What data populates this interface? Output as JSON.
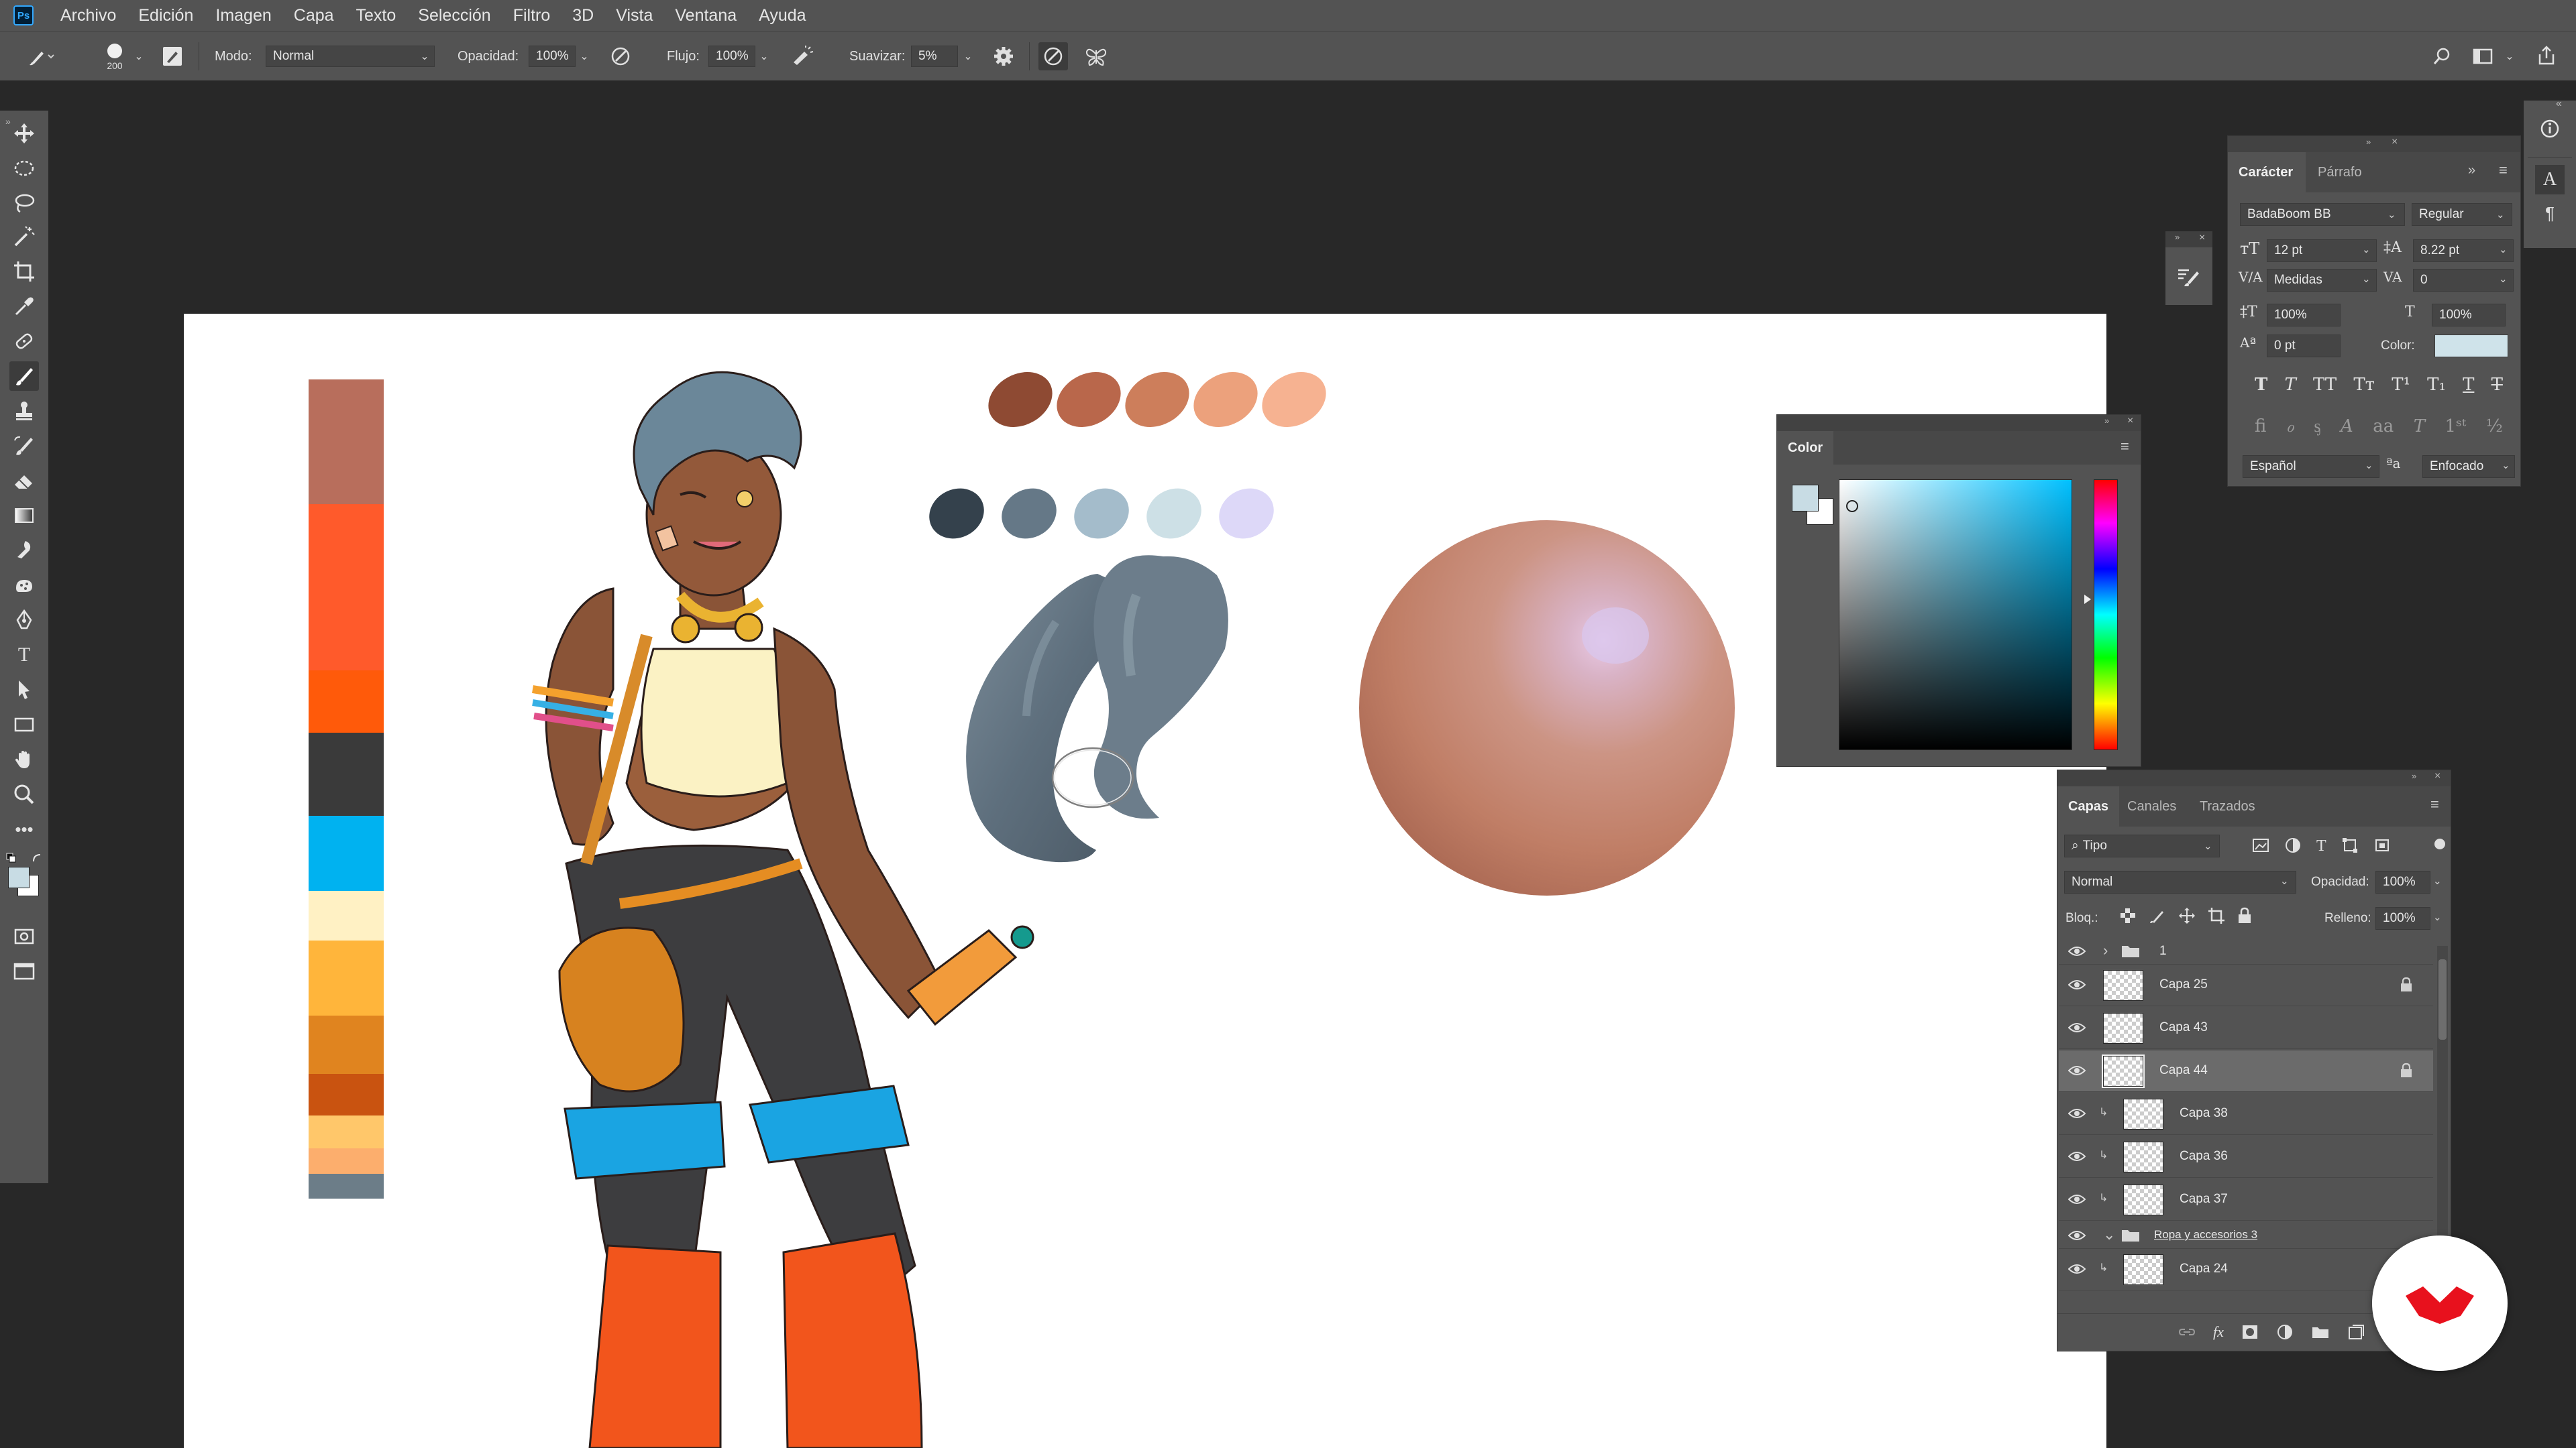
{
  "app": {
    "logo": "Ps"
  },
  "menu": [
    "Archivo",
    "Edición",
    "Imagen",
    "Capa",
    "Texto",
    "Selección",
    "Filtro",
    "3D",
    "Vista",
    "Ventana",
    "Ayuda"
  ],
  "options": {
    "brush_size": "200",
    "mode_label": "Modo:",
    "mode_value": "Normal",
    "opacity_label": "Opacidad:",
    "opacity_value": "100%",
    "flow_label": "Flujo:",
    "flow_value": "100%",
    "smoothing_label": "Suavizar:",
    "smoothing_value": "5%"
  },
  "toolbar": {
    "tools": [
      "move-tool",
      "marquee-tool",
      "lasso-tool",
      "magic-wand-tool",
      "crop-tool",
      "eyedropper-tool",
      "healing-brush-tool",
      "brush-tool",
      "clone-stamp-tool",
      "history-brush-tool",
      "eraser-tool",
      "gradient-tool",
      "blur-tool",
      "dodge-tool",
      "pen-tool",
      "type-tool",
      "path-selection-tool",
      "rectangle-tool",
      "hand-tool",
      "zoom-tool",
      "more-tools",
      "quick-mask",
      "screen-mode"
    ],
    "active_tool": "brush-tool",
    "foreground_color": "#c8dce4",
    "background_color": "#ffffff"
  },
  "canvas": {
    "palette": [
      "#b86e5c",
      "#ff5a2b",
      "#ff5a0a",
      "#3a3a3a",
      "#00b2f0",
      "#fff1c4",
      "#ffb53b",
      "#e0841f",
      "#c95310",
      "#ffc76a",
      "#fcae6d",
      "#6c7d88"
    ],
    "skin_swatches": [
      "#8e4a33",
      "#b9674b",
      "#cd7e5b",
      "#eca17c",
      "#f6b291"
    ],
    "hair_swatches": [
      "#34414c",
      "#657887",
      "#a4bccb",
      "#cde0e6",
      "#ddd8f8"
    ]
  },
  "character_panel": {
    "tabs": [
      "Carácter",
      "Párrafo"
    ],
    "font_family": "BadaBoom BB",
    "font_style": "Regular",
    "font_size": "12 pt",
    "leading": "8.22 pt",
    "kerning": "Medidas",
    "tracking": "0",
    "vertical_scale": "100%",
    "horizontal_scale": "100%",
    "baseline_shift": "0 pt",
    "color_label": "Color:",
    "color_value": "#cfe3ea",
    "language": "Español",
    "antialias": "Enfocado"
  },
  "color_panel": {
    "title": "Color",
    "foreground": "#c8dce4",
    "background": "#ffffff",
    "hue_color": "#00c0ff"
  },
  "layers_panel": {
    "tabs": [
      "Capas",
      "Canales",
      "Trazados"
    ],
    "filter_kind": "Tipo",
    "blend_mode": "Normal",
    "opacity_label": "Opacidad:",
    "opacity_value": "100%",
    "lock_label": "Bloq.:",
    "fill_label": "Relleno:",
    "fill_value": "100%",
    "layers": [
      {
        "name": "1",
        "type": "group",
        "indent": 0,
        "locked": false,
        "selected": false
      },
      {
        "name": "Capa 25",
        "type": "layer",
        "indent": 0,
        "locked": true,
        "selected": false
      },
      {
        "name": "Capa 43",
        "type": "layer",
        "indent": 0,
        "locked": false,
        "selected": false
      },
      {
        "name": "Capa 44",
        "type": "layer",
        "indent": 0,
        "locked": true,
        "selected": true
      },
      {
        "name": "Capa 38",
        "type": "layer",
        "indent": 1,
        "locked": false,
        "selected": false
      },
      {
        "name": "Capa 36",
        "type": "layer",
        "indent": 1,
        "locked": false,
        "selected": false
      },
      {
        "name": "Capa 37",
        "type": "layer",
        "indent": 1,
        "locked": false,
        "selected": false
      },
      {
        "name": "Ropa y accesorios 3",
        "type": "group",
        "indent": 0,
        "locked": false,
        "selected": false
      },
      {
        "name": "Capa 24",
        "type": "layer",
        "indent": 1,
        "locked": false,
        "selected": false
      }
    ]
  },
  "badge": {
    "logo": "domestika-logo"
  }
}
